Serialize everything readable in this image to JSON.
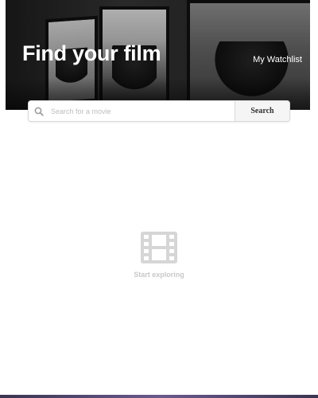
{
  "hero": {
    "title": "Find your film",
    "watchlist_label": "My Watchlist"
  },
  "search": {
    "placeholder": "Search for a movie",
    "value": "",
    "button_label": "Search",
    "icon": "search-icon"
  },
  "empty_state": {
    "icon": "film-icon",
    "text": "Start exploring"
  }
}
